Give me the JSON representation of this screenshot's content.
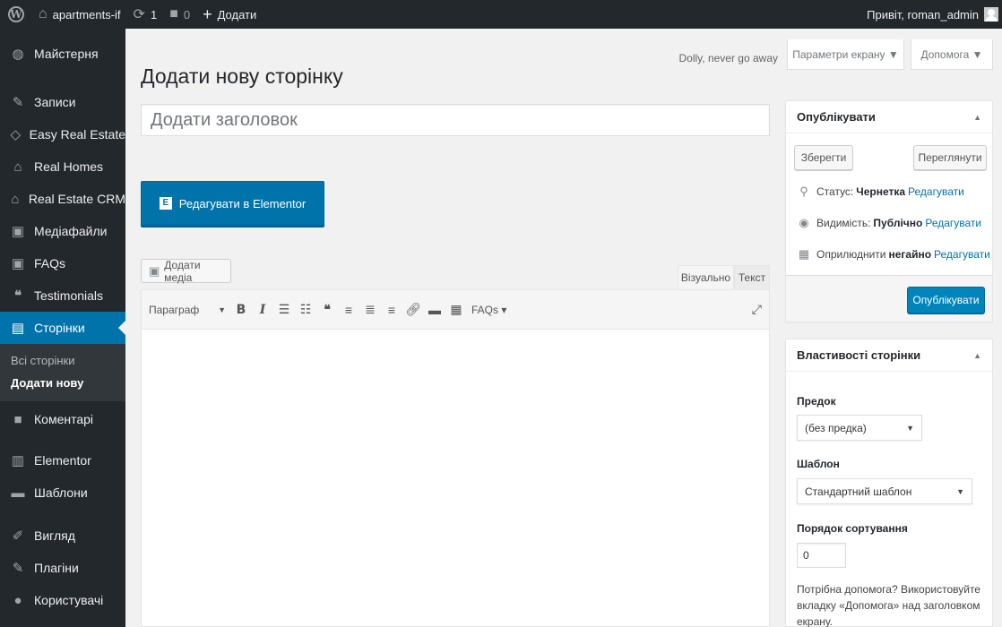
{
  "adminbar": {
    "site_name": "apartments-if",
    "updates_count": "1",
    "comments_count": "0",
    "new_label": "Додати",
    "greeting": "Привіт, roman_admin"
  },
  "sidebar": {
    "items": [
      {
        "label": "Майстерня",
        "icon": "dashboard-icon"
      },
      {
        "label": "Записи",
        "icon": "pin-icon"
      },
      {
        "label": "Easy Real Estate",
        "icon": "house-outline-icon"
      },
      {
        "label": "Real Homes",
        "icon": "house-outline-icon"
      },
      {
        "label": "Real Estate CRM",
        "icon": "house-icon"
      },
      {
        "label": "Медіафайли",
        "icon": "media-icon"
      },
      {
        "label": "FAQs",
        "icon": "media-icon"
      },
      {
        "label": "Testimonials",
        "icon": "quote-icon"
      },
      {
        "label": "Сторінки",
        "icon": "page-icon"
      },
      {
        "label": "Коментарі",
        "icon": "comment-icon"
      },
      {
        "label": "Elementor",
        "icon": "elementor-icon"
      },
      {
        "label": "Шаблони",
        "icon": "folder-icon"
      },
      {
        "label": "Вигляд",
        "icon": "brush-icon"
      },
      {
        "label": "Плагіни",
        "icon": "plug-icon"
      },
      {
        "label": "Користувачі",
        "icon": "user-icon"
      }
    ],
    "submenu": [
      "Всі сторінки",
      "Додати нову"
    ]
  },
  "header": {
    "dolly": "Dolly, never go away",
    "screen_options": "Параметри екрану ▼",
    "help": "Допомога ▼",
    "page_title": "Додати нову сторінку"
  },
  "editor": {
    "title_placeholder": "Додати заголовок",
    "elementor_button": "Редагувати в Elementor",
    "add_media": "Додати медіа",
    "tab_visual": "Візуально",
    "tab_text": "Текст",
    "format": "Параграф",
    "faqs": "FAQs ▾",
    "content": ""
  },
  "publish_box": {
    "title": "Опублікувати",
    "save": "Зберегти",
    "preview": "Переглянути",
    "status_label": "Статус:",
    "status_value": "Чернетка",
    "visibility_label": "Видимість:",
    "visibility_value": "Публічно",
    "publish_label": "Оприлюднити",
    "publish_value": "негайно",
    "edit_link": "Редагувати",
    "publish_button": "Опублікувати"
  },
  "attributes_box": {
    "title": "Властивості сторінки",
    "parent_label": "Предок",
    "parent_value": "(без предка)",
    "template_label": "Шаблон",
    "template_value": "Стандартний шаблон",
    "order_label": "Порядок сортування",
    "order_value": "0",
    "help_text": "Потрібна допомога? Використовуйте вкладку «Допомога» над заголовком екрану."
  }
}
